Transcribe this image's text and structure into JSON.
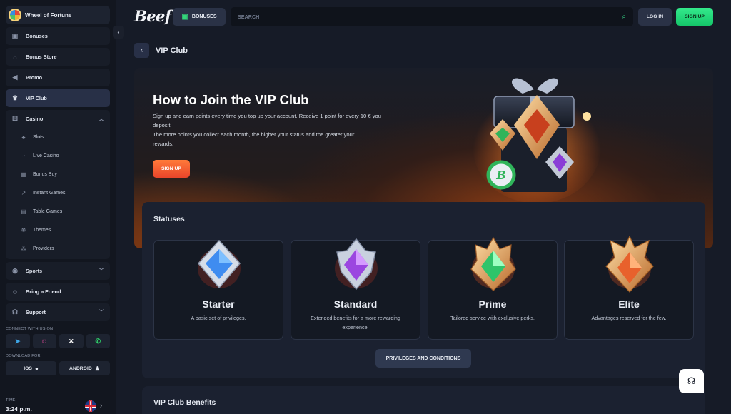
{
  "sidebar": {
    "wheel_label": "Wheel of Fortune",
    "items": [
      {
        "label": "Bonuses",
        "icon": "gift-icon"
      },
      {
        "label": "Bonus Store",
        "icon": "store-icon"
      },
      {
        "label": "Promo",
        "icon": "megaphone-icon"
      },
      {
        "label": "VIP Club",
        "icon": "crown-icon",
        "active": true
      }
    ],
    "casino": {
      "label": "Casino",
      "subitems": [
        "Slots",
        "Live Casino",
        "Bonus Buy",
        "Instant Games",
        "Table Games",
        "Themes",
        "Providers"
      ]
    },
    "sports_label": "Sports",
    "friend_label": "Bring a Friend",
    "support_label": "Support",
    "connect_label": "CONNECT WITH US ON",
    "download_label": "DOWNLOAD FOR",
    "ios_label": "IOS",
    "android_label": "ANDROID",
    "time_label": "TIME",
    "time_value": "3:24 p.m."
  },
  "header": {
    "logo": "Beef",
    "bonuses_label": "BONUSES",
    "search_placeholder": "SEARCH",
    "login_label": "LOG IN",
    "signup_label": "SIGN UP"
  },
  "page": {
    "title": "VIP Club"
  },
  "hero": {
    "heading": "How to Join the VIP Club",
    "text1": "Sign up and earn points every time you top up your account. Receive 1 point for every 10 € you deposit.",
    "text2": "The more points you collect each month, the higher your status and the greater your rewards.",
    "signup_label": "SIGN UP"
  },
  "statuses": {
    "heading": "Statuses",
    "cards": [
      {
        "name": "Starter",
        "desc": "A basic set of privileges.",
        "gem_color": "#3f8cf0"
      },
      {
        "name": "Standard",
        "desc": "Extended benefits for a more rewarding experience.",
        "gem_color": "#9b46e0"
      },
      {
        "name": "Prime",
        "desc": "Tailored service with exclusive perks.",
        "gem_color": "#2fc46a"
      },
      {
        "name": "Elite",
        "desc": "Advantages reserved for the few.",
        "gem_color": "#e8612c"
      }
    ],
    "privileges_label": "PRIVILEGES AND CONDITIONS"
  },
  "benefits": {
    "heading": "VIP Club Benefits"
  },
  "colors": {
    "accent_green": "#1fd676",
    "accent_orange": "#f0582e",
    "panel": "#1b2130"
  }
}
